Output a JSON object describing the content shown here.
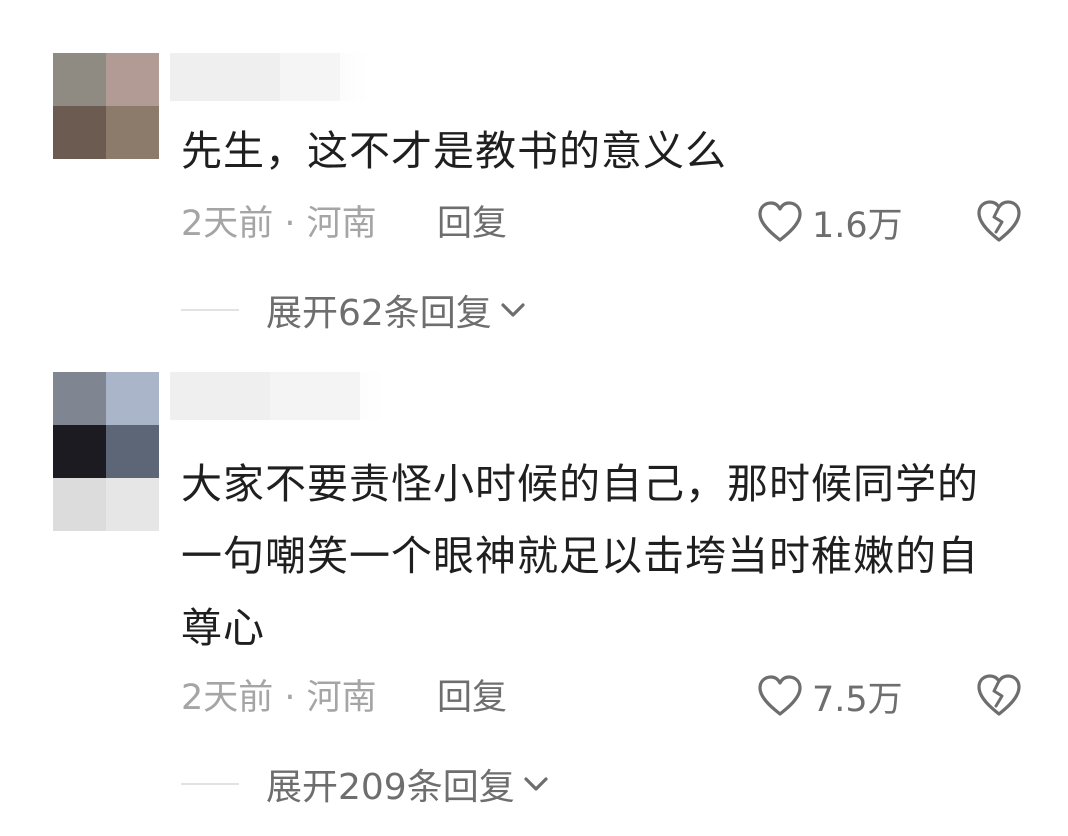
{
  "comments": [
    {
      "text": "先生，这不才是教书的意义么",
      "meta": "2天前 · 河南",
      "reply_label": "回复",
      "like_count": "1.6万",
      "expand_label": "展开62条回复",
      "avatar_colors": [
        "#8f8a82",
        "#b29b95",
        "#6b5b51",
        "#8c7a6a"
      ]
    },
    {
      "text": "大家不要责怪小时候的自己，那时候同学的一句嘲笑一个眼神就足以击垮当时稚嫩的自尊心",
      "meta": "2天前 · 河南",
      "reply_label": "回复",
      "like_count": "7.5万",
      "expand_label": "展开209条回复",
      "avatar_colors": [
        "#7f8591",
        "#aab5ca",
        "#1c1b21",
        "#5d6676"
      ]
    }
  ],
  "icons": {
    "like": "heart-outline-icon",
    "dislike": "broken-heart-icon",
    "expand": "chevron-down-icon"
  },
  "colors": {
    "text": "#1f1f1f",
    "meta": "#a5a5a5",
    "action": "#6e6e6e"
  }
}
